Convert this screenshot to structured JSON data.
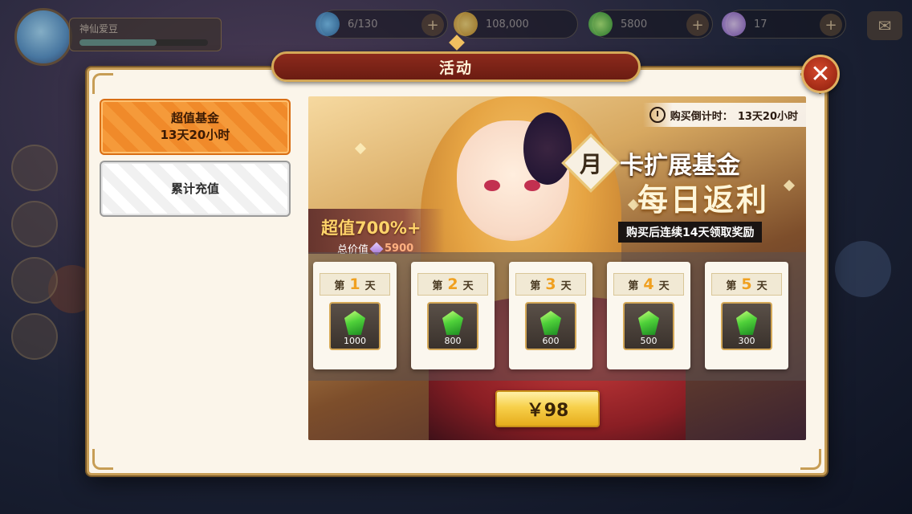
{
  "window": {
    "title": "活动"
  },
  "hud": {
    "player_name": "神仙爱豆",
    "resources": [
      {
        "icon": "energy-icon",
        "value": "6/130"
      },
      {
        "icon": "gold-coin-icon",
        "value": "108,000"
      },
      {
        "icon": "green-gem-icon",
        "value": "5800"
      },
      {
        "icon": "purple-gem-icon",
        "value": "17"
      }
    ]
  },
  "tabs": [
    {
      "line1": "超值基金",
      "line2": "13天20小时",
      "active": true
    },
    {
      "line1": "累计充值",
      "line2": "",
      "active": false
    }
  ],
  "banner": {
    "countdown_label": "购买倒计时：",
    "countdown_value": "13天20小时",
    "fund_char": "月",
    "fund_title": "卡扩展基金",
    "daily_return": "每日返利",
    "reward_tip": "购买后连续14天领取奖励",
    "value_pct": "超值700%+",
    "total_label": "总价值",
    "total_value": "5900"
  },
  "days": [
    {
      "prefix": "第",
      "num": "1",
      "suffix": "天",
      "qty": "1000"
    },
    {
      "prefix": "第",
      "num": "2",
      "suffix": "天",
      "qty": "800"
    },
    {
      "prefix": "第",
      "num": "3",
      "suffix": "天",
      "qty": "600"
    },
    {
      "prefix": "第",
      "num": "4",
      "suffix": "天",
      "qty": "500"
    },
    {
      "prefix": "第",
      "num": "5",
      "suffix": "天",
      "qty": "300"
    }
  ],
  "buy": {
    "price": "￥98"
  },
  "colors": {
    "accent_orange": "#f08a2a",
    "title_red": "#8c2a1c",
    "gold_border": "#c79d55",
    "buy_gold": "#f7d04a"
  }
}
